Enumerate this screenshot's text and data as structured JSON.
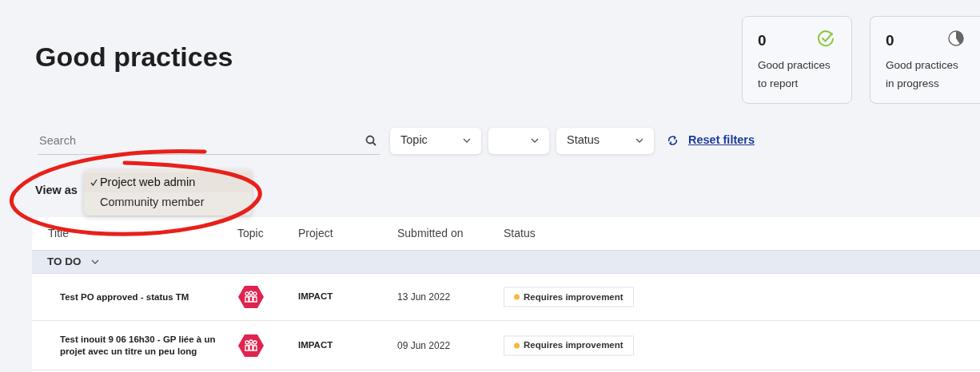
{
  "page_title": "Good practices",
  "stat_cards": [
    {
      "value": "0",
      "label": "Good practices to report",
      "kind": "check"
    },
    {
      "value": "0",
      "label": "Good practices in progress",
      "kind": "pie"
    }
  ],
  "filters": {
    "search": {
      "placeholder": "Search"
    },
    "dropdowns": [
      {
        "kind": "labeled",
        "value": "Topic"
      },
      {
        "kind": "blank"
      },
      {
        "kind": "labeled",
        "value": "Status"
      }
    ],
    "reset": "Reset filters"
  },
  "view_as": {
    "label": "View as",
    "options": [
      {
        "label": "Project web admin",
        "selected": true
      },
      {
        "label": "Community member",
        "selected": false
      }
    ]
  },
  "table": {
    "columns": [
      "Title",
      "Topic",
      "Project",
      "Submitted on",
      "Status"
    ],
    "groups": [
      {
        "label": "TO DO",
        "expanded": true,
        "rows": [
          {
            "title": "Test PO approved - status TM",
            "project": "IMPACT",
            "submitted_on": "13 Jun 2022",
            "status": "Requires improvement",
            "color": "#f5b83d"
          },
          {
            "title": "Test inouit 9 06 16h30 - GP liée à un projet avec un titre un peu long",
            "project": "IMPACT",
            "submitted_on": "09 Jun 2022",
            "status": "Requires improvement",
            "color": "#f5b83d"
          }
        ]
      }
    ]
  }
}
